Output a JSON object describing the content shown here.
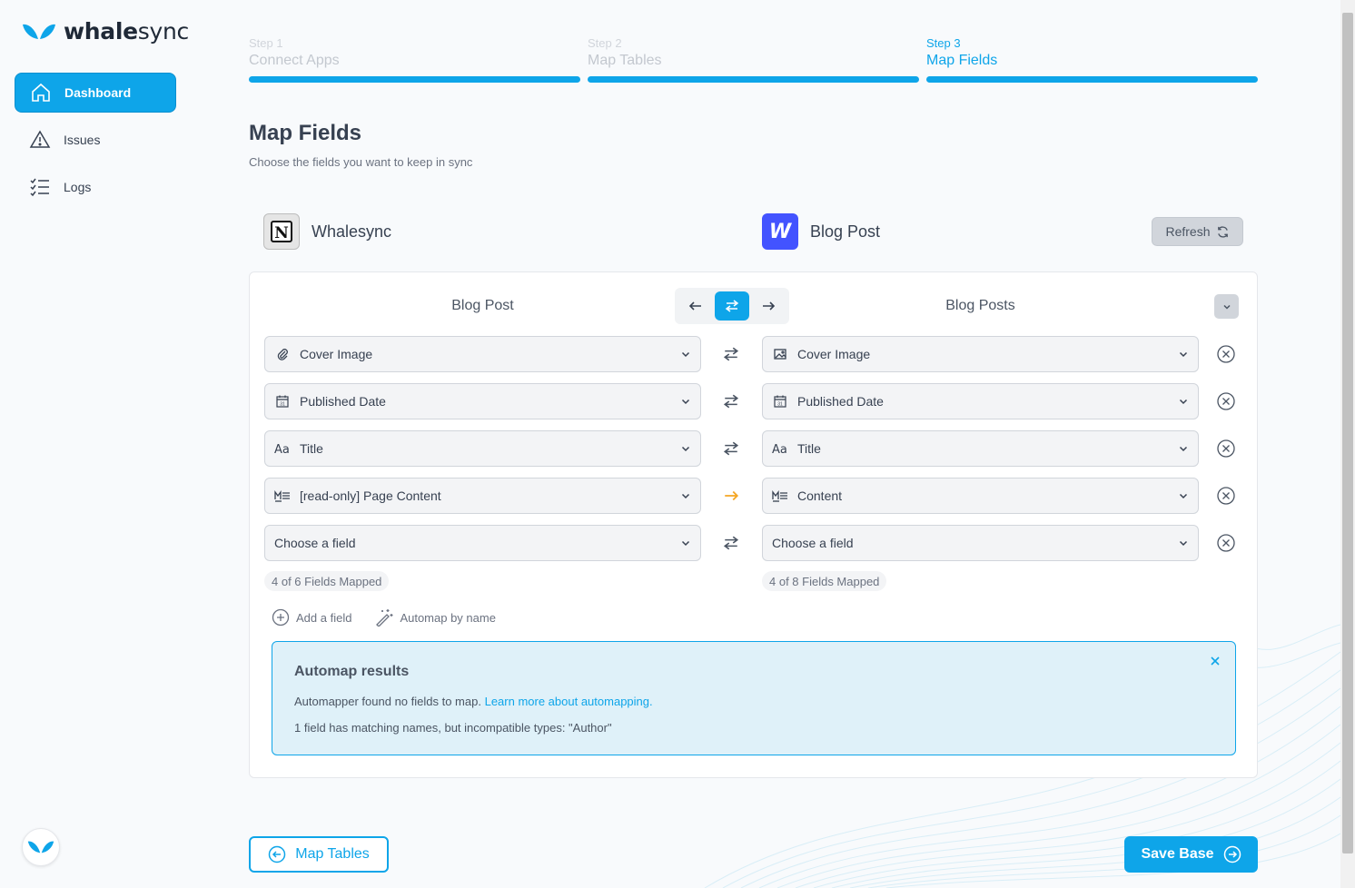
{
  "brand": {
    "name_bold": "whale",
    "name_rest": "sync",
    "accent": "#0ea5e9"
  },
  "sidebar": {
    "items": [
      {
        "label": "Dashboard",
        "icon": "home-icon",
        "active": true
      },
      {
        "label": "Issues",
        "icon": "warning-icon"
      },
      {
        "label": "Logs",
        "icon": "checklist-icon"
      }
    ]
  },
  "steps": [
    {
      "num": "Step 1",
      "label": "Connect Apps"
    },
    {
      "num": "Step 2",
      "label": "Map Tables"
    },
    {
      "num": "Step 3",
      "label": "Map Fields"
    }
  ],
  "page": {
    "title": "Map Fields",
    "subtitle": "Choose the fields you want to keep in sync"
  },
  "left_app": {
    "name": "Whalesync",
    "icon": "notion-icon",
    "icon_letter": "N",
    "table": "Blog Post"
  },
  "right_app": {
    "name": "Blog Post",
    "icon": "webflow-icon",
    "icon_letter": "W",
    "table": "Blog Posts"
  },
  "refresh_label": "Refresh",
  "rows": [
    {
      "left": "Cover Image",
      "left_icon": "paperclip-icon",
      "right": "Cover Image",
      "right_icon": "image-icon",
      "direction": "both"
    },
    {
      "left": "Published Date",
      "left_icon": "calendar-icon",
      "right": "Published Date",
      "right_icon": "calendar-icon",
      "direction": "both"
    },
    {
      "left": "Title",
      "left_icon": "text-icon",
      "right": "Title",
      "right_icon": "text-icon",
      "direction": "both"
    },
    {
      "left": "[read-only] Page Content",
      "left_icon": "markdown-icon",
      "right": "Content",
      "right_icon": "markdown-icon",
      "direction": "right"
    },
    {
      "left": "Choose a field",
      "left_icon": "",
      "right": "Choose a field",
      "right_icon": "",
      "direction": "both"
    }
  ],
  "left_mapped": "4 of 6 Fields Mapped",
  "right_mapped": "4 of 8 Fields Mapped",
  "actions": {
    "add_field": "Add a field",
    "automap": "Automap by name"
  },
  "alert": {
    "title": "Automap results",
    "line1": "Automapper found no fields to map.",
    "link": "Learn more about automapping.",
    "line2": "1 field has matching names, but incompatible types: \"Author\""
  },
  "footer": {
    "back_label": "Map Tables",
    "save_label": "Save Base"
  }
}
